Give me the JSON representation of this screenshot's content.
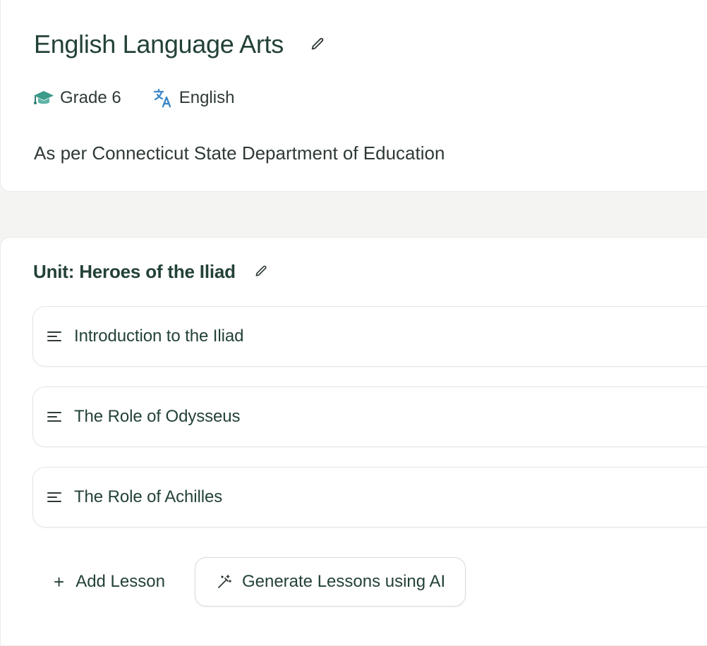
{
  "course": {
    "title": "English Language Arts",
    "grade": "Grade 6",
    "language": "English",
    "description": "As per Connecticut State Department of Education"
  },
  "unit": {
    "title": "Unit: Heroes of the Iliad",
    "lessons": [
      {
        "title": "Introduction to the Iliad"
      },
      {
        "title": "The Role of Odysseus"
      },
      {
        "title": "The Role of Achilles"
      }
    ]
  },
  "actions": {
    "add_lesson_label": "Add Lesson",
    "generate_label": "Generate Lessons using AI"
  },
  "icons": {
    "edit": "pencil-icon",
    "grade": "graduation-cap-icon",
    "language": "translate-icon",
    "lesson": "lines-icon",
    "add": "plus-icon",
    "generate": "magic-wand-icon"
  },
  "colors": {
    "heading": "#234236",
    "grade_icon": "#3c9a8a",
    "language_icon": "#3a86c8",
    "border": "#e4e6e3",
    "background": "#f4f4f3"
  }
}
